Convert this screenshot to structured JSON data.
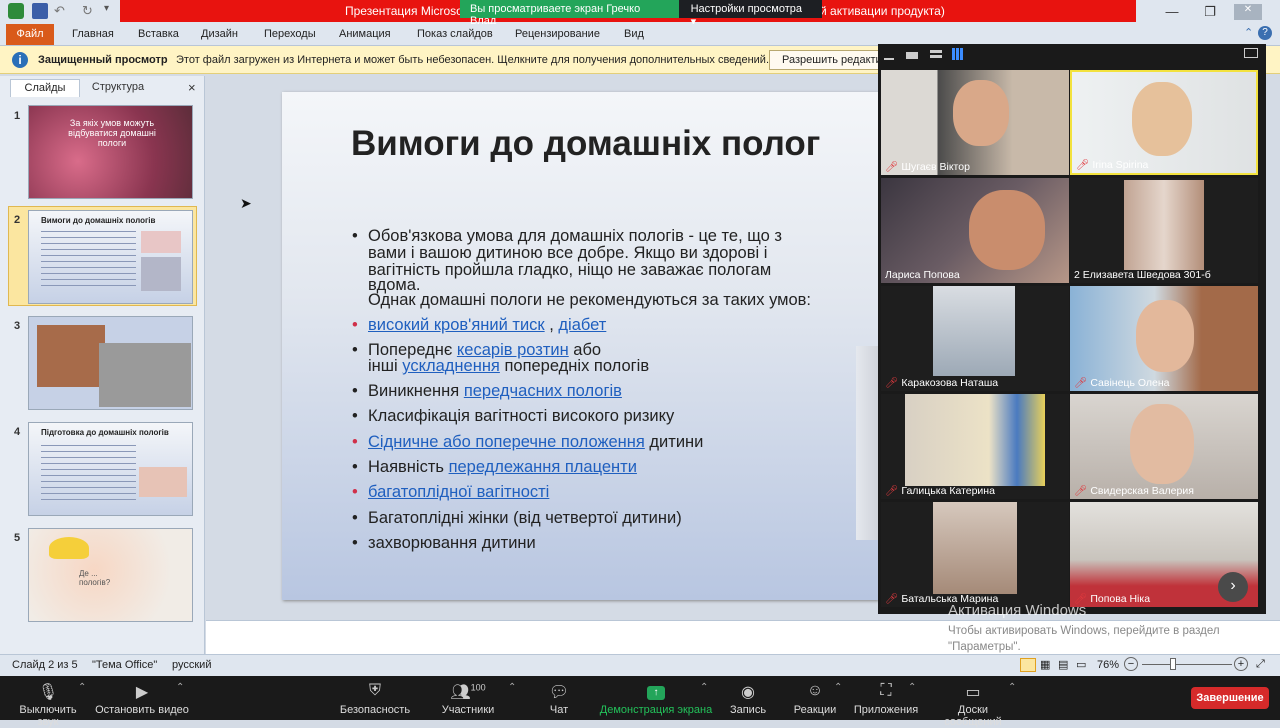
{
  "titlebar": {
    "doc_title_left": "Презентация Microsof",
    "doc_title_right": "й активации продукта)",
    "zoom_banner_view": "Вы просматриваете экран Гречко Влад",
    "zoom_banner_settings": "Настройки просмотра",
    "chevron": "▾"
  },
  "ribbon": {
    "file": "Файл",
    "tabs": [
      "Главная",
      "Вставка",
      "Дизайн",
      "Переходы",
      "Анимация",
      "Показ слайдов",
      "Рецензирование",
      "Вид"
    ]
  },
  "protected_view": {
    "title": "Защищенный просмотр",
    "message": "Этот файл загружен из Интернета и может быть небезопасен. Щелкните для получения дополнительных сведений.",
    "button": "Разрешить редакти"
  },
  "left_panel": {
    "tab_slides": "Слайды",
    "tab_outline": "Структура",
    "close": "×",
    "thumbnails": [
      {
        "num": "1",
        "text": "За якіх умов можуть відбуватися домашні пологи"
      },
      {
        "num": "2",
        "text": "Вимоги до домашніх пологів"
      },
      {
        "num": "3",
        "text": ""
      },
      {
        "num": "4",
        "text": "Підготовка до домашніх пологів"
      },
      {
        "num": "5",
        "text": "Де ... пологів?"
      }
    ]
  },
  "slide": {
    "title": "Вимоги до домашніх полог",
    "para1_l1": "Обов'язкова умова для домашніх  пологів - це те, що з",
    "para1_l2": "вами і вашою дитиною  все добре. Якщо ви здорові і",
    "para1_l3": "вагітність пройшла гладко, ніщо не заважає пологам",
    "para1_l4": "вдома.",
    "para1_l5": "Однак домашні пологи не рекомендуються за таких умов:",
    "b1_link1": "високий  кров'яний  тиск",
    "b1_sep": " , ",
    "b1_link2": "діабет",
    "b2_a": "Попереднє ",
    "b2_link": "кесарів розтин",
    "b2_b": " або",
    "b2_c": "інші ",
    "b2_link2": "ускладнення",
    "b2_d": " попередніх  пологів",
    "b3_a": "Виникнення  ",
    "b3_link": "передчасних  пологів",
    "b4": "Класифікація  вагітності  високого  ризику",
    "b5_link": "Сідничне  або поперечне  положення",
    "b5_b": "  дитини",
    "b6_a": "Наявність  ",
    "b6_link": "передлежання  плаценти",
    "b7_link": "багатоплідної  вагітності",
    "b8": "Багатоплідні  жінки  (від четвертої дитини)",
    "b9": "захворювання  дитини"
  },
  "status": {
    "slide": "Слайд 2 из 5",
    "theme": "\"Тема Office\"",
    "lang": "русский",
    "zoom": "76%",
    "minus": "−",
    "plus": "+"
  },
  "participants": [
    {
      "name": "Шугаєв Віктор",
      "muted": true
    },
    {
      "name": "Irina Spirina",
      "muted": true
    },
    {
      "name": "Лариса Попова",
      "muted": false
    },
    {
      "name": "2 Елизавета Шведова 301-б",
      "muted": false
    },
    {
      "name": "Каракозова Наташа",
      "muted": true
    },
    {
      "name": "Савінець Олена",
      "muted": true
    },
    {
      "name": "Галицька Катерина",
      "muted": true
    },
    {
      "name": "Свидерская Валерия",
      "muted": true
    },
    {
      "name": "Батальська Марина",
      "muted": true
    },
    {
      "name": "Попова Ніка",
      "muted": true
    }
  ],
  "activation": {
    "title": "Активация Windows",
    "message": "Чтобы активировать Windows, перейдите в раздел \"Параметры\"."
  },
  "toolbar": {
    "mute": "Выключить звук",
    "video": "Остановить видео",
    "security": "Безопасность",
    "participants": "Участники",
    "participants_count": "100",
    "chat": "Чат",
    "share": "Демонстрация экрана",
    "record": "Запись",
    "reactions": "Реакции",
    "apps": "Приложения",
    "whiteboards": "Доски сообщений",
    "end": "Завершение"
  },
  "colors": {
    "accent_red": "#e8130f",
    "zoom_green": "#23a55a",
    "file_orange": "#d95a1a",
    "link_blue": "#1f5fbf"
  }
}
